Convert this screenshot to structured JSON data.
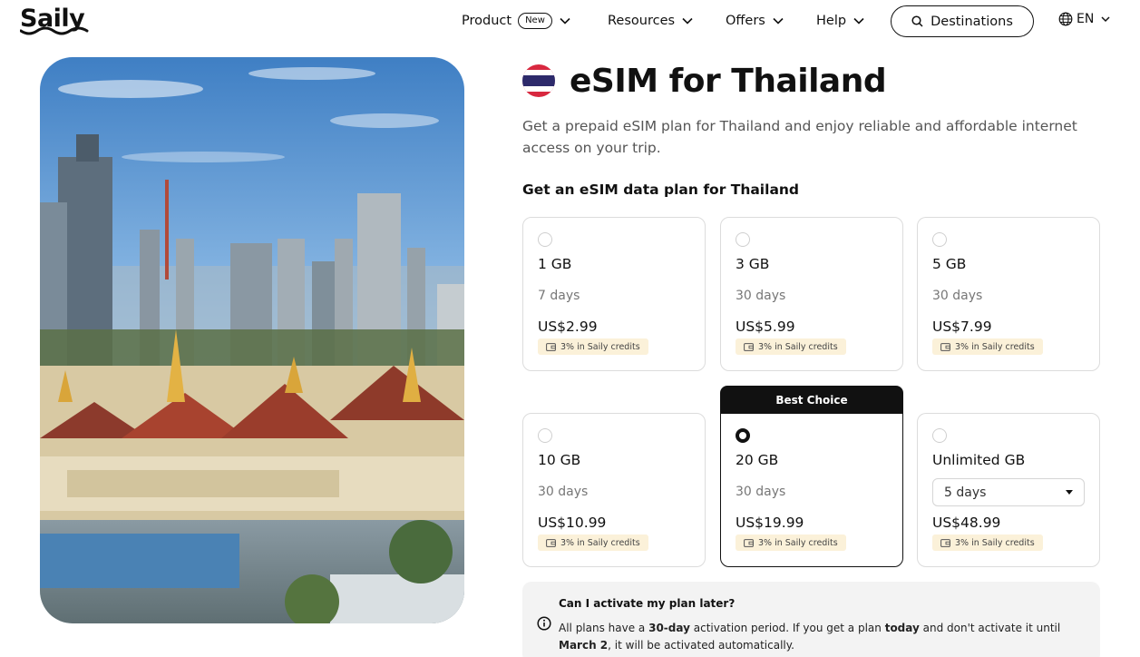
{
  "brand": {
    "logo_text": "Saily"
  },
  "nav": {
    "items": [
      {
        "label": "Product",
        "badge": "New"
      },
      {
        "label": "Resources"
      },
      {
        "label": "Offers"
      },
      {
        "label": "Help"
      }
    ],
    "destinations_label": "Destinations",
    "language": "EN"
  },
  "hero": {
    "image_subject": "Bangkok skyline with Grand Palace"
  },
  "page": {
    "title": "eSIM for Thailand",
    "subtitle": "Get a prepaid eSIM plan for Thailand and enjoy reliable and affordable internet access on your trip.",
    "section_title": "Get an eSIM data plan for Thailand"
  },
  "plans": [
    {
      "data": "1 GB",
      "duration": "7 days",
      "price": "US$2.99",
      "credits": "3% in Saily credits",
      "selected": false
    },
    {
      "data": "3 GB",
      "duration": "30 days",
      "price": "US$5.99",
      "credits": "3% in Saily credits",
      "selected": false
    },
    {
      "data": "5 GB",
      "duration": "30 days",
      "price": "US$7.99",
      "credits": "3% in Saily credits",
      "selected": false
    },
    {
      "data": "10 GB",
      "duration": "30 days",
      "price": "US$10.99",
      "credits": "3% in Saily credits",
      "selected": false
    },
    {
      "data": "20 GB",
      "duration": "30 days",
      "price": "US$19.99",
      "credits": "3% in Saily credits",
      "selected": true,
      "tag": "Best Choice"
    },
    {
      "data": "Unlimited GB",
      "duration": "5 days",
      "price": "US$48.99",
      "credits": "3% in Saily credits",
      "selected": false,
      "duration_selector": true
    }
  ],
  "info": {
    "question": "Can I activate my plan later?",
    "answer_part1": "All plans have a ",
    "answer_bold1": "30-day",
    "answer_part2": " activation period. If you get a plan ",
    "answer_bold2": "today",
    "answer_part3": " and don't activate it until ",
    "answer_bold3": "March 2",
    "answer_part4": ", it will be activated automatically."
  },
  "colors": {
    "text_primary": "#111111",
    "text_secondary": "#555555",
    "card_border": "#dcdcdc",
    "credits_badge_bg": "#fbf1d9",
    "info_bg": "#f3f3f3",
    "flag_red": "#d8283f",
    "flag_blue": "#2d2a6b"
  }
}
